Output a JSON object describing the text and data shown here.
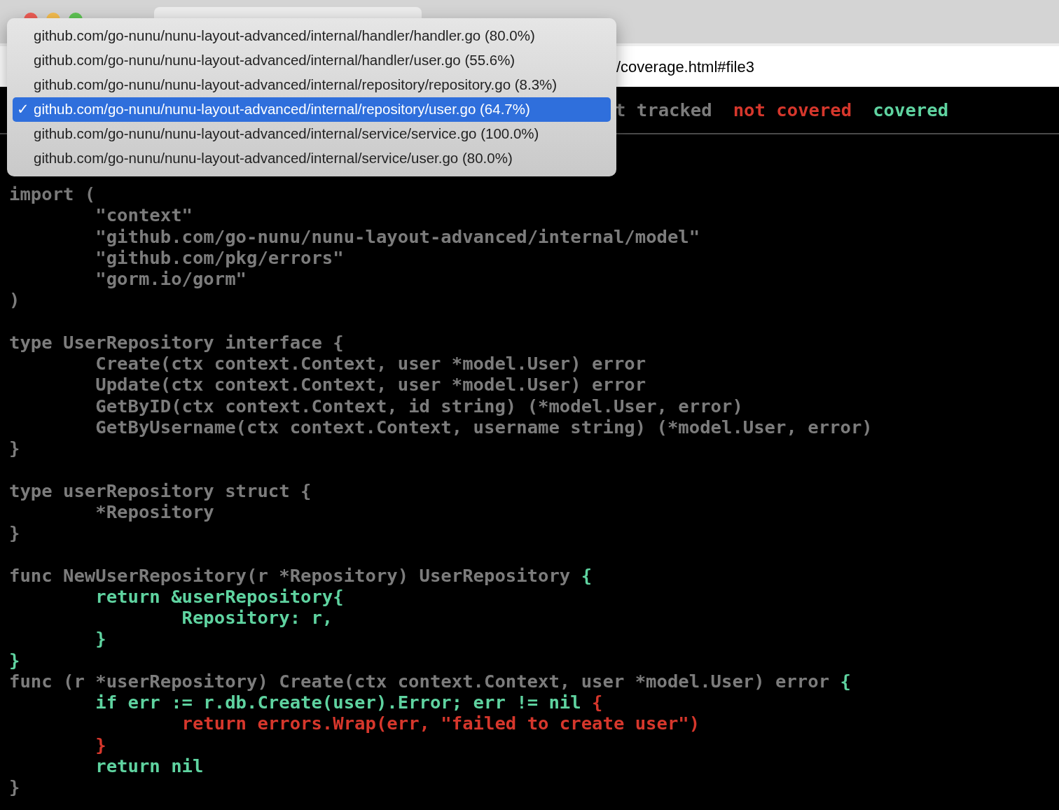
{
  "address_bar": {
    "url": "/coverage.html#file3"
  },
  "legend": [
    {
      "label": "t tracked",
      "kind": "tracked"
    },
    {
      "label": "not covered",
      "kind": "uncovered"
    },
    {
      "label": "covered",
      "kind": "covered"
    }
  ],
  "file_dropdown": {
    "check": "✓",
    "items": [
      {
        "label": "github.com/go-nunu/nunu-layout-advanced/internal/handler/handler.go (80.0%)",
        "selected": false
      },
      {
        "label": "github.com/go-nunu/nunu-layout-advanced/internal/handler/user.go (55.6%)",
        "selected": false
      },
      {
        "label": "github.com/go-nunu/nunu-layout-advanced/internal/repository/repository.go (8.3%)",
        "selected": false
      },
      {
        "label": "github.com/go-nunu/nunu-layout-advanced/internal/repository/user.go (64.7%)",
        "selected": true
      },
      {
        "label": "github.com/go-nunu/nunu-layout-advanced/internal/service/service.go (100.0%)",
        "selected": false
      },
      {
        "label": "github.com/go-nunu/nunu-layout-advanced/internal/service/user.go (80.0%)",
        "selected": false
      }
    ]
  },
  "code_blocks": [
    [
      [
        {
          "text": "import (",
          "kind": "tracked"
        }
      ],
      [
        {
          "text": "\t\"context\"",
          "kind": "tracked"
        }
      ],
      [
        {
          "text": "\t\"github.com/go-nunu/nunu-layout-advanced/internal/model\"",
          "kind": "tracked"
        }
      ],
      [
        {
          "text": "\t\"github.com/pkg/errors\"",
          "kind": "tracked"
        }
      ],
      [
        {
          "text": "\t\"gorm.io/gorm\"",
          "kind": "tracked"
        }
      ],
      [
        {
          "text": ")",
          "kind": "tracked"
        }
      ]
    ],
    [
      [
        {
          "text": "type UserRepository interface {",
          "kind": "tracked"
        }
      ],
      [
        {
          "text": "\tCreate(ctx context.Context, user *model.User) error",
          "kind": "tracked"
        }
      ],
      [
        {
          "text": "\tUpdate(ctx context.Context, user *model.User) error",
          "kind": "tracked"
        }
      ],
      [
        {
          "text": "\tGetByID(ctx context.Context, id string) (*model.User, error)",
          "kind": "tracked"
        }
      ],
      [
        {
          "text": "\tGetByUsername(ctx context.Context, username string) (*model.User, error)",
          "kind": "tracked"
        }
      ],
      [
        {
          "text": "}",
          "kind": "tracked"
        }
      ]
    ],
    [
      [
        {
          "text": "type userRepository struct {",
          "kind": "tracked"
        }
      ],
      [
        {
          "text": "\t*Repository",
          "kind": "tracked"
        }
      ],
      [
        {
          "text": "}",
          "kind": "tracked"
        }
      ]
    ],
    [
      [
        {
          "text": "func NewUserRepository(r *Repository) UserRepository ",
          "kind": "tracked"
        },
        {
          "text": "{",
          "kind": "covered"
        }
      ],
      [
        {
          "text": "\treturn &userRepository{",
          "kind": "covered"
        }
      ],
      [
        {
          "text": "\t\tRepository: r,",
          "kind": "covered"
        }
      ],
      [
        {
          "text": "\t}",
          "kind": "covered"
        }
      ],
      [
        {
          "text": "}",
          "kind": "covered"
        }
      ],
      [
        {
          "text": "func (r *userRepository) Create(ctx context.Context, user *model.User) error ",
          "kind": "tracked"
        },
        {
          "text": "{",
          "kind": "covered"
        }
      ],
      [
        {
          "text": "\tif err := r.db.Create(user).Error; err != nil ",
          "kind": "covered"
        },
        {
          "text": "{",
          "kind": "uncovered"
        }
      ],
      [
        {
          "text": "\t\treturn errors.Wrap(err, \"failed to create user\")",
          "kind": "uncovered"
        }
      ],
      [
        {
          "text": "\t}",
          "kind": "uncovered"
        }
      ],
      [
        {
          "text": "\treturn nil",
          "kind": "covered"
        }
      ],
      [
        {
          "text": "}",
          "kind": "tracked"
        }
      ]
    ]
  ]
}
